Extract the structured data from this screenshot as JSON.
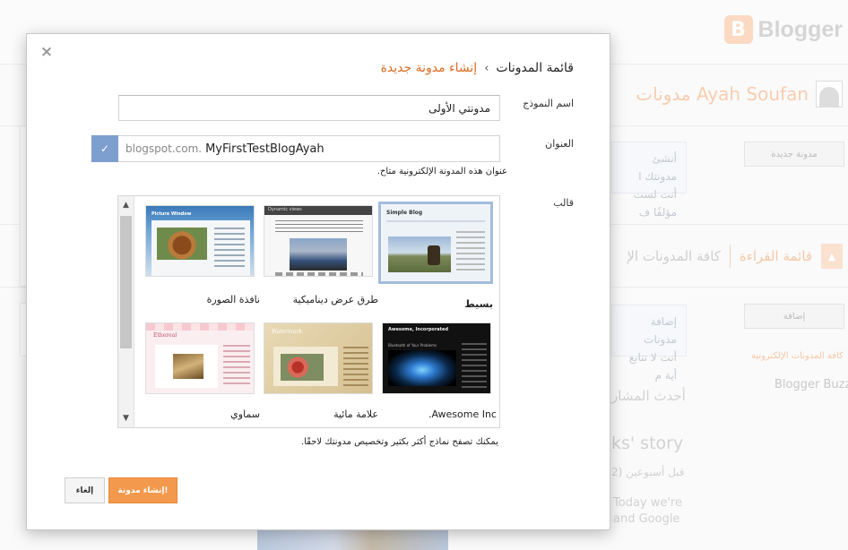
{
  "background": {
    "logo_mark": "B",
    "logo_text": "Blogger",
    "user_blogs_label": "مدونات Ayah Soufan",
    "new_blog_button": "مدونة جديدة",
    "callout_1_line1": "أنشئ مدونتك ا",
    "callout_1_line2": "أنت لست مؤلفًا ف",
    "reading_list_tab": "قائمة القراءة",
    "all_blogs_tab": "كافة المدونات الإ",
    "add_button": "إضافة",
    "callout_2_line1": "إضافة مدونات",
    "callout_2_line2": "أنت لا تتابع أية م",
    "blogs_link": "كافة المدونات الإلكترونية",
    "blogger_buzz": "Blogger Buzz",
    "latest_posts": "أحدث المشار",
    "story_title": "ks' story",
    "story_date": "قبل أسبوعين (2",
    "story_text1": "Today we're",
    "story_text2": "and Google"
  },
  "dialog": {
    "close_glyph": "×",
    "breadcrumb_root": "قائمة المدونات",
    "breadcrumb_sep": "›",
    "breadcrumb_current": "إنشاء مدونة جديدة",
    "title_label": "اسم النموذج",
    "title_value": "مدونتي الأولى",
    "address_label": "العنوان",
    "address_toggle": "✓",
    "address_suffix": "blogspot.com.",
    "address_value": "MyFirstTestBlogAyah",
    "address_status": "عنوان هذه المدونة الإلكترونية متاح.",
    "template_label": "قالب",
    "templates": [
      {
        "name": "بسيط",
        "selected": true
      },
      {
        "name": "طرق عرض ديناميكية",
        "selected": false
      },
      {
        "name": "نافذة الصورة",
        "selected": false
      },
      {
        "name": "Awesome Inc.",
        "selected": false
      },
      {
        "name": "علامة مائية",
        "selected": false
      },
      {
        "name": "سماوي",
        "selected": false
      }
    ],
    "thumb_texts": {
      "simple": "Simple Blog",
      "dynamic": "Dynamic views",
      "picture": "Picture Window",
      "awesome": "Awesome, Incorporated",
      "awesome_post": "Bluetooth of Your Problems",
      "watermark": "Watermark",
      "ethereal": "Ethereal"
    },
    "help_text": "يمكنك تصفح نماذج أكثر بكثير وتخصيص مدونتك لاحقًا.",
    "create_button": "إنشاء مدونة!",
    "cancel_button": "إلغاء",
    "scroll_up_glyph": "▲",
    "scroll_down_glyph": "▼"
  },
  "colors": {
    "accent": "#dd6a1f",
    "primary_button": "#f3994d",
    "toggle_blue": "#7d9fcf"
  }
}
